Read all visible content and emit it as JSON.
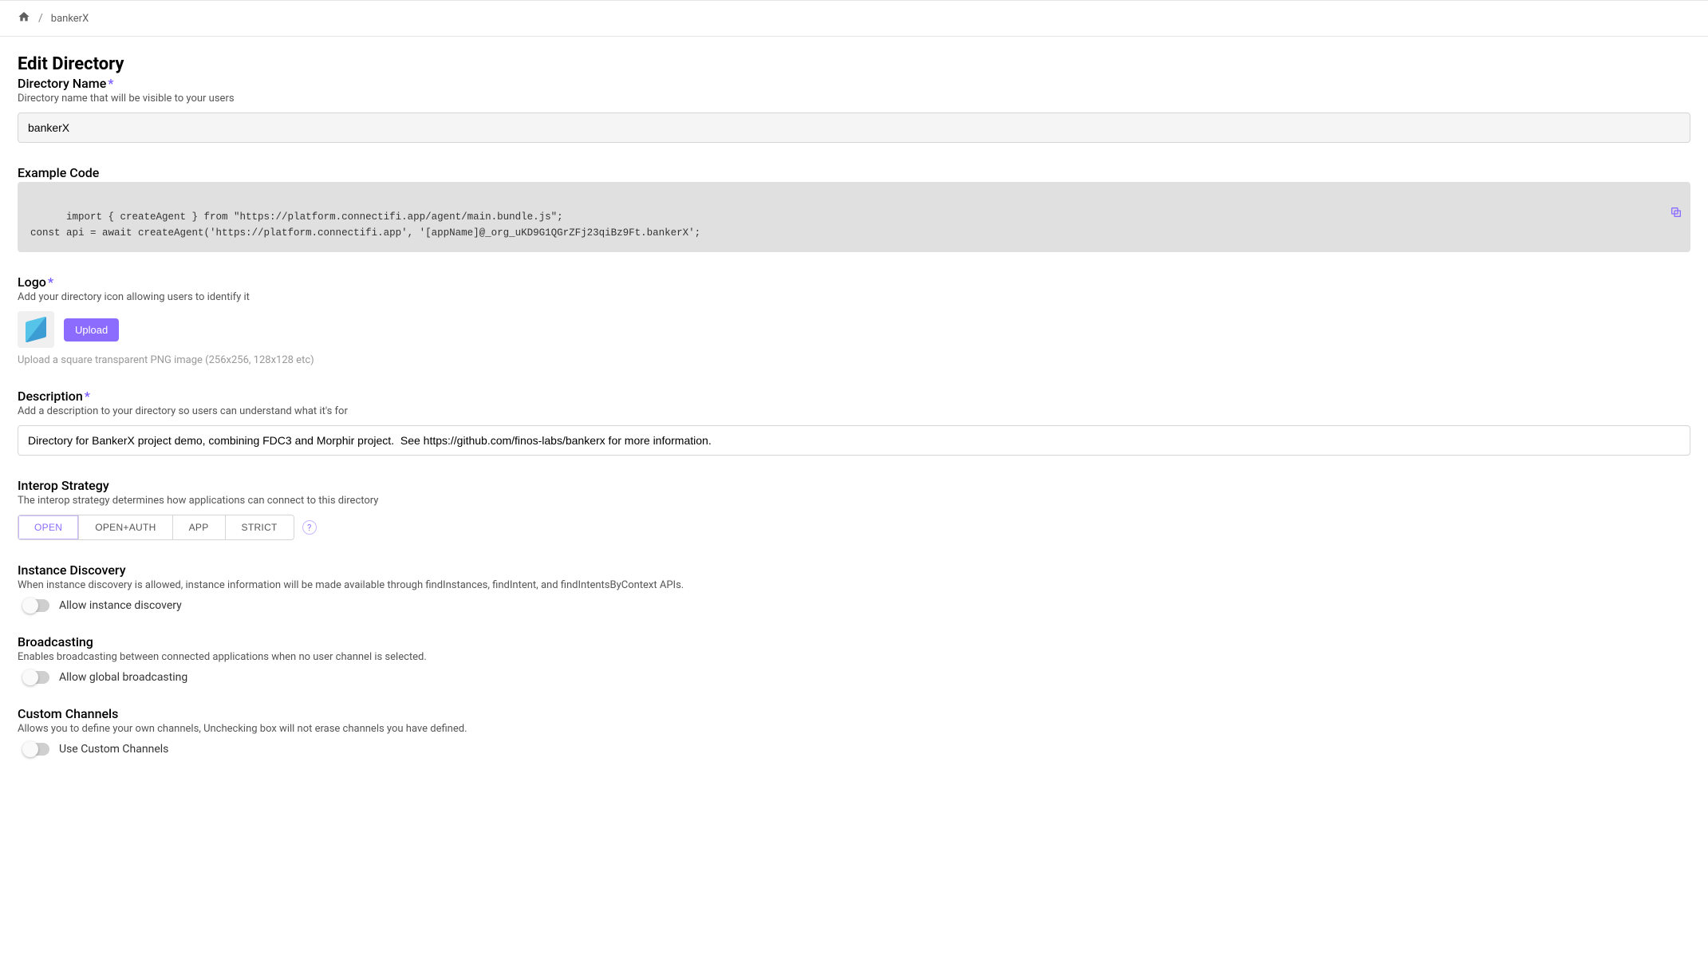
{
  "breadcrumb": {
    "current": "bankerX"
  },
  "page": {
    "title": "Edit Directory"
  },
  "directoryName": {
    "label": "Directory Name",
    "sub": "Directory name that will be visible to your users",
    "value": "bankerX"
  },
  "exampleCode": {
    "label": "Example Code",
    "code": "import { createAgent } from \"https://platform.connectifi.app/agent/main.bundle.js\";\nconst api = await createAgent('https://platform.connectifi.app', '[appName]@_org_uKD9G1QGrZFj23qiBz9Ft.bankerX';"
  },
  "logo": {
    "label": "Logo",
    "sub": "Add your directory icon allowing users to identify it",
    "uploadLabel": "Upload",
    "hint": "Upload a square transparent PNG image (256x256, 128x128 etc)"
  },
  "description": {
    "label": "Description",
    "sub": "Add a description to your directory so users can understand what it's for",
    "value": "Directory for BankerX project demo, combining FDC3 and Morphir project.  See https://github.com/finos-labs/bankerx for more information."
  },
  "interop": {
    "label": "Interop Strategy",
    "sub": "The interop strategy determines how applications can connect to this directory",
    "options": [
      "OPEN",
      "OPEN+AUTH",
      "APP",
      "STRICT"
    ],
    "selected": "OPEN"
  },
  "instanceDiscovery": {
    "label": "Instance Discovery",
    "sub": "When instance discovery is allowed, instance information will be made available through findInstances, findIntent, and findIntentsByContext APIs.",
    "toggleLabel": "Allow instance discovery",
    "value": false
  },
  "broadcasting": {
    "label": "Broadcasting",
    "sub": "Enables broadcasting between connected applications when no user channel is selected.",
    "toggleLabel": "Allow global broadcasting",
    "value": false
  },
  "customChannels": {
    "label": "Custom Channels",
    "sub": "Allows you to define your own channels, Unchecking box will not erase channels you have defined.",
    "toggleLabel": "Use Custom Channels",
    "value": false
  }
}
